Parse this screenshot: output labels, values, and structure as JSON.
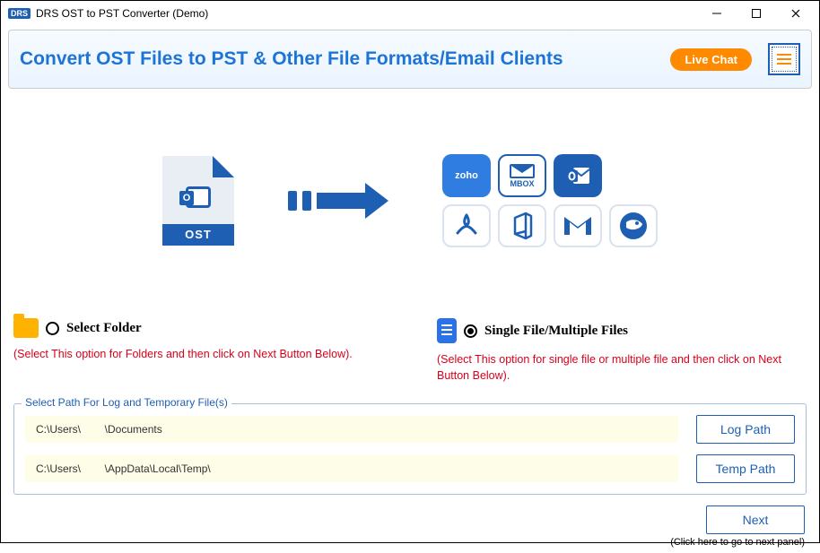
{
  "titlebar": {
    "logo": "DRS",
    "title": "DRS OST to PST Converter (Demo)"
  },
  "header": {
    "title": "Convert OST Files to PST & Other File Formats/Email Clients",
    "live_chat": "Live Chat"
  },
  "illustration": {
    "ost_label": "OST",
    "zoho": "zoho",
    "mbox": "MBOX"
  },
  "options": {
    "folder": {
      "label": "Select Folder",
      "desc": "(Select This option for Folders and then click on Next Button Below).",
      "selected": false
    },
    "file": {
      "label": "Single File/Multiple Files",
      "desc": "(Select This option for single file or multiple file and then click on Next Button Below).",
      "selected": true
    }
  },
  "paths": {
    "legend": "Select Path For Log and Temporary File(s)",
    "log_path": "C:\\Users\\        \\Documents",
    "temp_path": "C:\\Users\\        \\AppData\\Local\\Temp\\",
    "log_btn": "Log Path",
    "temp_btn": "Temp Path"
  },
  "footer": {
    "next": "Next",
    "hint": "(Click here to go to next panel)"
  }
}
